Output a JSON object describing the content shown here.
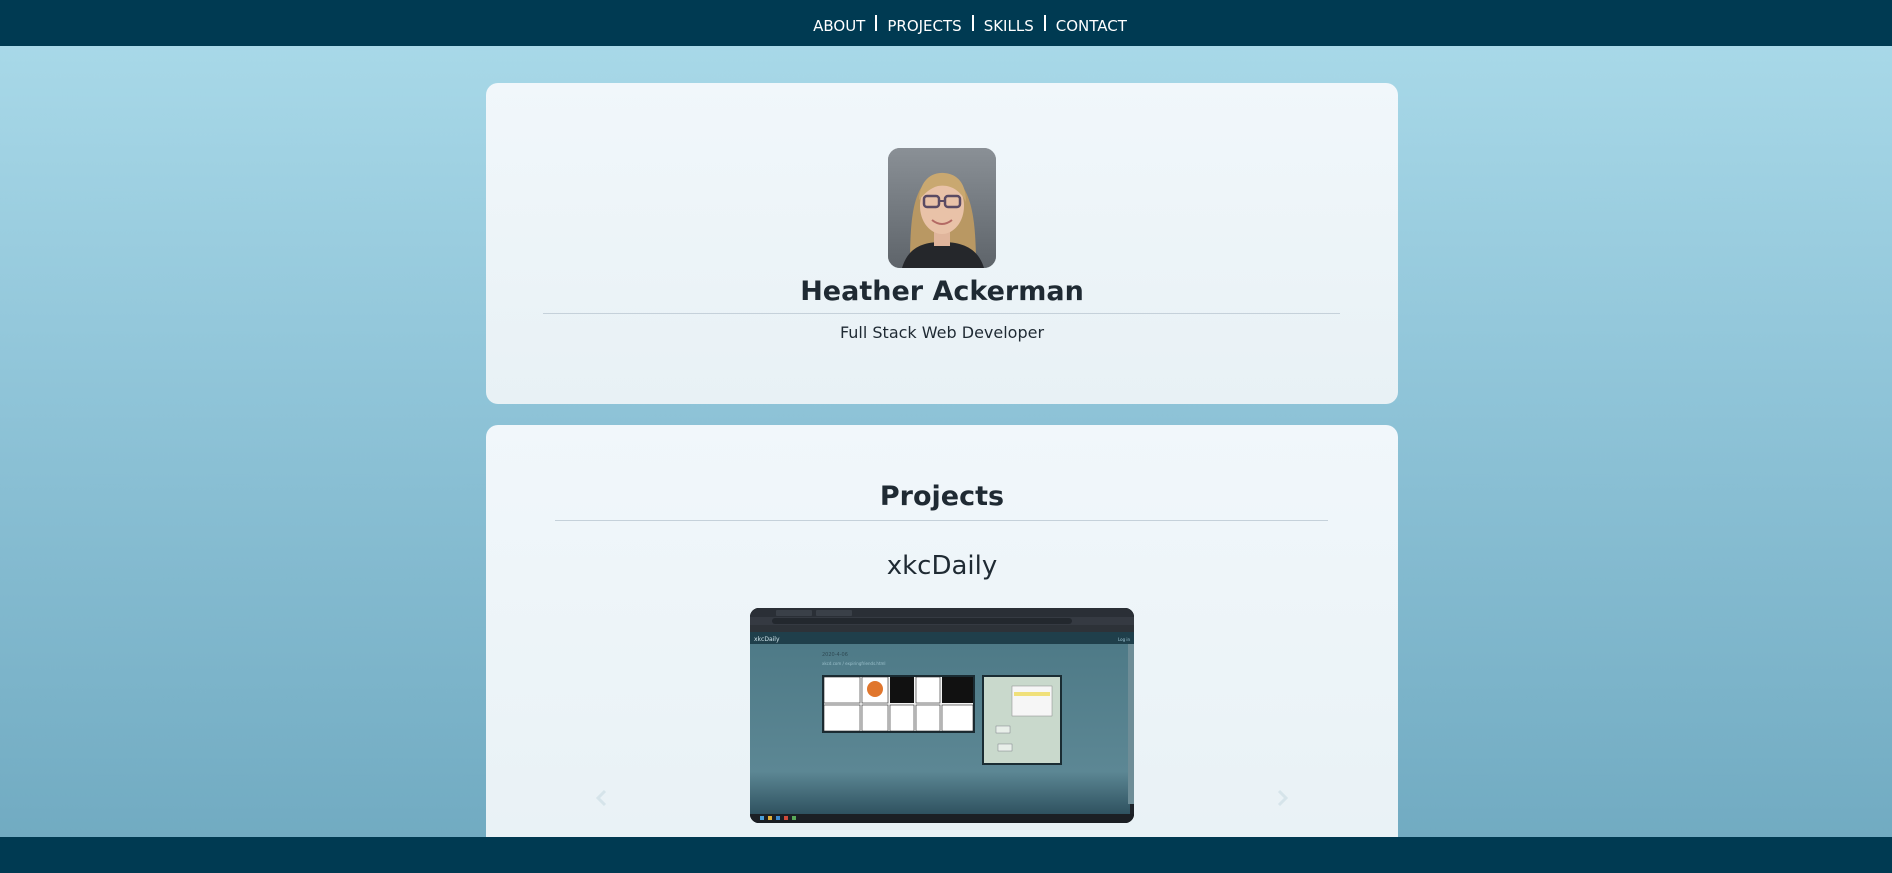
{
  "nav": {
    "items": [
      {
        "label": "ABOUT"
      },
      {
        "label": "PROJECTS"
      },
      {
        "label": "SKILLS"
      },
      {
        "label": "CONTACT"
      }
    ]
  },
  "about": {
    "name": "Heather Ackerman",
    "role": "Full Stack Web Developer",
    "avatar_icon": "profile-photo"
  },
  "projects": {
    "heading": "Projects",
    "current_project": {
      "title": "xkcDaily",
      "screenshot": {
        "app_name": "xkcDaily",
        "date": "2020-4-06",
        "url_text": "xkcd.com / expiringfriends.html",
        "nav_link": "Log in"
      }
    },
    "prev_icon": "chevron-left-icon",
    "next_icon": "chevron-right-icon"
  },
  "colors": {
    "nav_bg": "#003a52",
    "page_gradient_top": "#abdbea",
    "page_gradient_bottom": "#6fa9c0",
    "card_bg": "#f1f7fb",
    "text": "#1f2a33"
  }
}
